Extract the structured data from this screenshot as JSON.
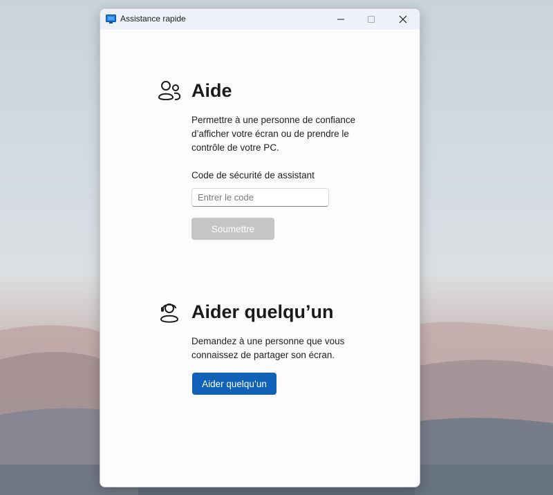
{
  "window": {
    "title": "Assistance rapide",
    "controls": {
      "minimize": "minimize-icon",
      "maximize": "maximize-icon",
      "close": "close-icon"
    }
  },
  "get_help": {
    "icon": "people-icon",
    "title": "Aide",
    "description": "Permettre à une personne de confiance d’afficher votre écran ou de prendre le contrôle de votre PC.",
    "code_label": "Code de sécurité de assistant",
    "code_value": "",
    "code_placeholder": "Entrer le code",
    "submit_label": "Soumettre",
    "submit_enabled": false
  },
  "give_help": {
    "icon": "person-headset-icon",
    "title": "Aider quelqu’un",
    "description": "Demandez à une personne que vous connaissez de partager son écran.",
    "button_label": "Aider quelqu’un"
  },
  "colors": {
    "accent": "#0f62b7",
    "disabled": "#c5c5c5",
    "titlebar": "#eef2f8",
    "window_bg": "#fcfcfc"
  }
}
